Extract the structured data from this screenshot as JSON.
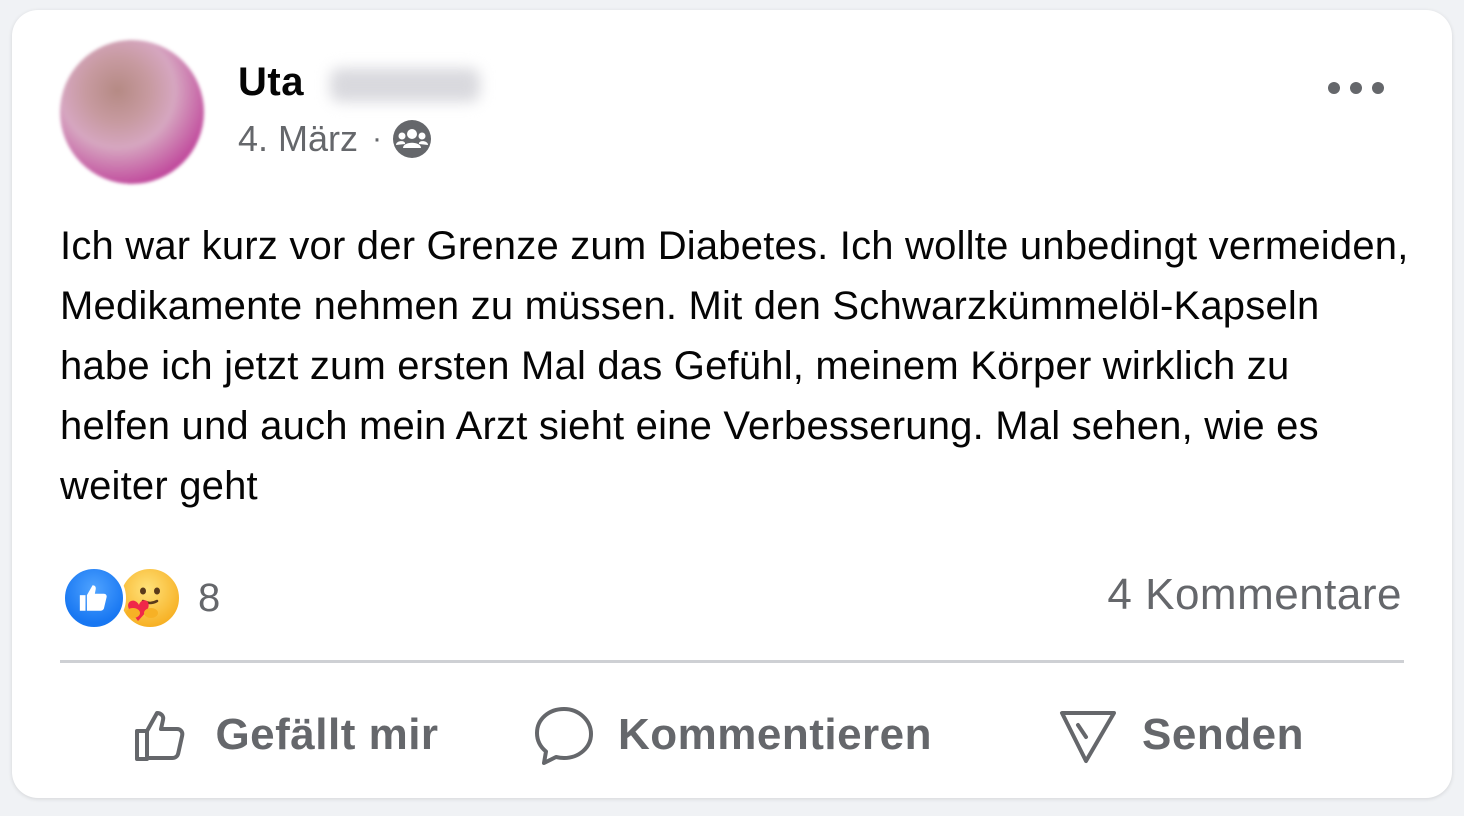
{
  "post": {
    "author_first": "Uta",
    "date": "4. März",
    "separator": "·",
    "audience_icon": "friends-icon",
    "text": "Ich war kurz vor der Grenze zum Diabetes. Ich wollte unbedingt vermeiden, Medikamente nehmen zu müssen. Mit den Schwarzkümmelöl-Kapseln habe ich jetzt zum ersten Mal das Gefühl, meinem Körper wirklich zu helfen und auch mein Arzt sieht eine Verbesserung. Mal sehen, wie es weiter geht"
  },
  "reactions": {
    "types": [
      "like",
      "care"
    ],
    "count": "8"
  },
  "comments": {
    "label": "4 Kommentare"
  },
  "actions": {
    "like_label": "Gefällt mir",
    "comment_label": "Kommentieren",
    "send_label": "Senden"
  },
  "colors": {
    "accent": "#1877f2",
    "secondary_text": "#65676b",
    "divider": "#ced0d4"
  }
}
